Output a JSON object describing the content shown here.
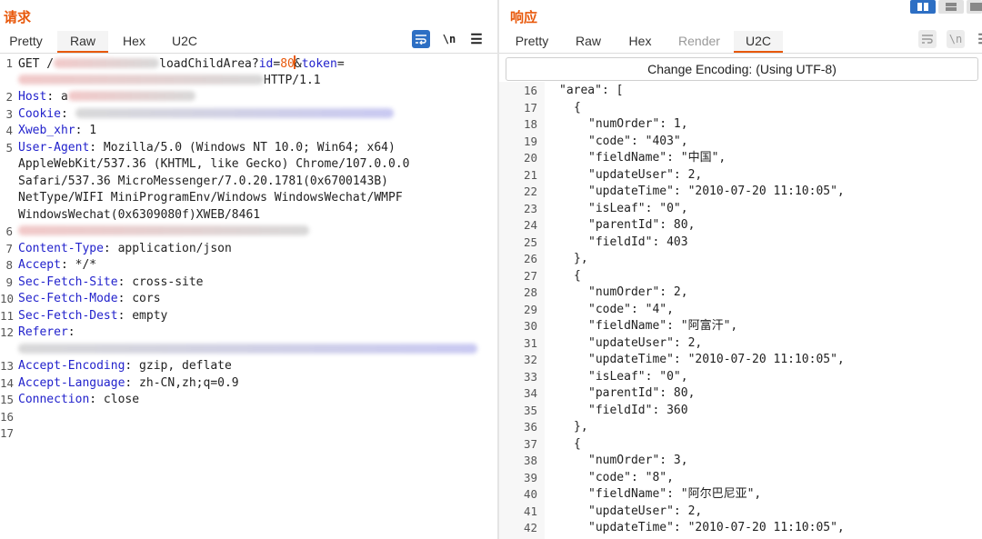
{
  "request": {
    "title": "请求",
    "tabs": [
      {
        "label": "Pretty",
        "active": false
      },
      {
        "label": "Raw",
        "active": true
      },
      {
        "label": "Hex",
        "active": false
      },
      {
        "label": "U2C",
        "active": false
      }
    ],
    "tools": {
      "wrap_icon": "wrap-lines-icon",
      "newline_label": "\\n",
      "menu_icon": "hamburger-menu-icon"
    },
    "lines": [
      {
        "n": "1",
        "parts": [
          {
            "t": "GET /",
            "c": ""
          },
          {
            "t": "",
            "blur": true,
            "w": 116
          },
          {
            "t": "loadChildArea?",
            "c": ""
          },
          {
            "t": "id",
            "c": "hname"
          },
          {
            "t": "=",
            "c": ""
          },
          {
            "t": "80",
            "c": "val"
          },
          {
            "caret": true
          },
          {
            "t": "&",
            "c": ""
          },
          {
            "t": "token",
            "c": "hname"
          },
          {
            "t": "=",
            "c": ""
          }
        ]
      },
      {
        "n": "",
        "parts": [
          {
            "t": "",
            "blur": true,
            "w": 270
          },
          {
            "t": "HTTP/1.1",
            "c": ""
          }
        ]
      },
      {
        "n": "2",
        "parts": [
          {
            "t": "Host",
            "c": "hname"
          },
          {
            "t": ": a",
            "c": ""
          },
          {
            "t": "",
            "blur": true,
            "w": 140
          }
        ]
      },
      {
        "n": "3",
        "parts": [
          {
            "t": "Cookie",
            "c": "hname"
          },
          {
            "t": ": ",
            "c": ""
          },
          {
            "t": "",
            "blur": true,
            "w": 350
          }
        ]
      },
      {
        "n": "4",
        "parts": [
          {
            "t": "Xweb_xhr",
            "c": "hname"
          },
          {
            "t": ": 1",
            "c": ""
          }
        ]
      },
      {
        "n": "5",
        "parts": [
          {
            "t": "User-Agent",
            "c": "hname"
          },
          {
            "t": ": Mozilla/5.0 (Windows NT 10.0; Win64; x64)",
            "c": ""
          }
        ]
      },
      {
        "n": "",
        "parts": [
          {
            "t": "AppleWebKit/537.36 (KHTML, like Gecko) Chrome/107.0.0.0",
            "c": ""
          }
        ]
      },
      {
        "n": "",
        "parts": [
          {
            "t": "Safari/537.36 MicroMessenger/7.0.20.1781(0x6700143B)",
            "c": ""
          }
        ]
      },
      {
        "n": "",
        "parts": [
          {
            "t": "NetType/WIFI MiniProgramEnv/Windows WindowsWechat/WMPF",
            "c": ""
          }
        ]
      },
      {
        "n": "",
        "parts": [
          {
            "t": "WindowsWechat(0x6309080f)XWEB/8461",
            "c": ""
          }
        ]
      },
      {
        "n": "6",
        "parts": [
          {
            "t": "",
            "blur": true,
            "w": 320
          }
        ]
      },
      {
        "n": "7",
        "parts": [
          {
            "t": "Content-Type",
            "c": "hname"
          },
          {
            "t": ": application/json",
            "c": ""
          }
        ]
      },
      {
        "n": "8",
        "parts": [
          {
            "t": "Accept",
            "c": "hname"
          },
          {
            "t": ": */*",
            "c": ""
          }
        ]
      },
      {
        "n": "9",
        "parts": [
          {
            "t": "Sec-Fetch-Site",
            "c": "hname"
          },
          {
            "t": ": cross-site",
            "c": ""
          }
        ]
      },
      {
        "n": "10",
        "parts": [
          {
            "t": "Sec-Fetch-Mode",
            "c": "hname"
          },
          {
            "t": ": cors",
            "c": ""
          }
        ]
      },
      {
        "n": "11",
        "parts": [
          {
            "t": "Sec-Fetch-Dest",
            "c": "hname"
          },
          {
            "t": ": empty",
            "c": ""
          }
        ]
      },
      {
        "n": "12",
        "parts": [
          {
            "t": "Referer",
            "c": "hname"
          },
          {
            "t": ":",
            "c": ""
          }
        ]
      },
      {
        "n": "",
        "parts": [
          {
            "t": "",
            "blur": true,
            "w": 505
          }
        ]
      },
      {
        "n": "13",
        "parts": [
          {
            "t": "Accept-Encoding",
            "c": "hname"
          },
          {
            "t": ": gzip, deflate",
            "c": ""
          }
        ]
      },
      {
        "n": "14",
        "parts": [
          {
            "t": "Accept-Language",
            "c": "hname"
          },
          {
            "t": ": zh-CN,zh;q=0.9",
            "c": ""
          }
        ]
      },
      {
        "n": "15",
        "parts": [
          {
            "t": "Connection",
            "c": "hname"
          },
          {
            "t": ": close",
            "c": ""
          }
        ]
      },
      {
        "n": "16",
        "parts": []
      },
      {
        "n": "17",
        "parts": []
      }
    ]
  },
  "response": {
    "title": "响应",
    "tabs": [
      {
        "label": "Pretty",
        "active": false,
        "disabled": false
      },
      {
        "label": "Raw",
        "active": false,
        "disabled": false
      },
      {
        "label": "Hex",
        "active": false,
        "disabled": false
      },
      {
        "label": "Render",
        "active": false,
        "disabled": true
      },
      {
        "label": "U2C",
        "active": true,
        "disabled": false
      }
    ],
    "tools": {
      "wrap_icon": "wrap-lines-icon",
      "newline_label": "\\n",
      "menu_icon": "hamburger-menu-icon"
    },
    "encoding_button": "Change Encoding: (Using UTF-8)",
    "lines": [
      {
        "n": "16",
        "i": 0,
        "t": "\"area\": ["
      },
      {
        "n": "17",
        "i": 1,
        "t": "{"
      },
      {
        "n": "18",
        "i": 2,
        "t": "\"numOrder\": 1,"
      },
      {
        "n": "19",
        "i": 2,
        "t": "\"code\": \"403\","
      },
      {
        "n": "20",
        "i": 2,
        "t": "\"fieldName\": \"中国\","
      },
      {
        "n": "21",
        "i": 2,
        "t": "\"updateUser\": 2,"
      },
      {
        "n": "22",
        "i": 2,
        "t": "\"updateTime\": \"2010-07-20 11:10:05\","
      },
      {
        "n": "23",
        "i": 2,
        "t": "\"isLeaf\": \"0\","
      },
      {
        "n": "24",
        "i": 2,
        "t": "\"parentId\": 80,"
      },
      {
        "n": "25",
        "i": 2,
        "t": "\"fieldId\": 403"
      },
      {
        "n": "26",
        "i": 1,
        "t": "},"
      },
      {
        "n": "27",
        "i": 1,
        "t": "{"
      },
      {
        "n": "28",
        "i": 2,
        "t": "\"numOrder\": 2,"
      },
      {
        "n": "29",
        "i": 2,
        "t": "\"code\": \"4\","
      },
      {
        "n": "30",
        "i": 2,
        "t": "\"fieldName\": \"阿富汗\","
      },
      {
        "n": "31",
        "i": 2,
        "t": "\"updateUser\": 2,"
      },
      {
        "n": "32",
        "i": 2,
        "t": "\"updateTime\": \"2010-07-20 11:10:05\","
      },
      {
        "n": "33",
        "i": 2,
        "t": "\"isLeaf\": \"0\","
      },
      {
        "n": "34",
        "i": 2,
        "t": "\"parentId\": 80,"
      },
      {
        "n": "35",
        "i": 2,
        "t": "\"fieldId\": 360"
      },
      {
        "n": "36",
        "i": 1,
        "t": "},"
      },
      {
        "n": "37",
        "i": 1,
        "t": "{"
      },
      {
        "n": "38",
        "i": 2,
        "t": "\"numOrder\": 3,"
      },
      {
        "n": "39",
        "i": 2,
        "t": "\"code\": \"8\","
      },
      {
        "n": "40",
        "i": 2,
        "t": "\"fieldName\": \"阿尔巴尼亚\","
      },
      {
        "n": "41",
        "i": 2,
        "t": "\"updateUser\": 2,"
      },
      {
        "n": "42",
        "i": 2,
        "t": "\"updateTime\": \"2010-07-20 11:10:05\","
      }
    ]
  },
  "colors": {
    "accent": "#e8590c",
    "header_name": "#2222cc",
    "param_value": "#e8590c",
    "toggle_on": "#2d6fc4"
  },
  "layout_toggle": {
    "icons": [
      "side-by-side-layout-icon",
      "stacked-layout-icon",
      "single-layout-icon"
    ],
    "selected": "side-by-side-layout-icon"
  }
}
